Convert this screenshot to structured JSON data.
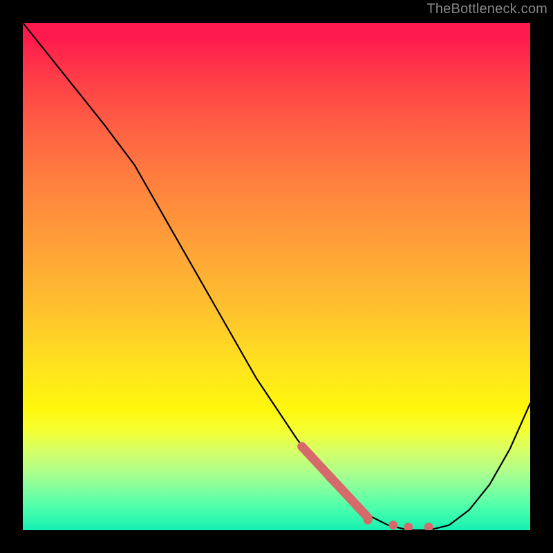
{
  "watermark": "TheBottleneck.com",
  "chart_data": {
    "type": "line",
    "title": "",
    "xlabel": "",
    "ylabel": "",
    "xlim": [
      0,
      100
    ],
    "ylim": [
      0,
      100
    ],
    "grid": false,
    "legend": false,
    "background_gradient": {
      "direction": "vertical",
      "stops": [
        {
          "pos": 0.0,
          "color": "#ff1a4d"
        },
        {
          "pos": 0.35,
          "color": "#ff8a3d"
        },
        {
          "pos": 0.68,
          "color": "#ffe41e"
        },
        {
          "pos": 0.88,
          "color": "#b4ff88"
        },
        {
          "pos": 1.0,
          "color": "#17efb2"
        }
      ]
    },
    "series": [
      {
        "name": "bottleneck-curve",
        "x": [
          0,
          8,
          16,
          22,
          30,
          38,
          46,
          54,
          60,
          64,
          68,
          72,
          76,
          80,
          84,
          88,
          92,
          96,
          100
        ],
        "y": [
          100,
          90,
          80,
          72,
          58,
          44,
          30,
          18,
          10,
          6,
          3,
          1,
          0,
          0,
          1,
          4,
          9,
          16,
          25
        ]
      }
    ],
    "highlight_segment": {
      "name": "thick-salmon-segment",
      "x": [
        55,
        68
      ],
      "y": [
        16.5,
        2.5
      ]
    },
    "highlight_points": {
      "name": "salmon-dots",
      "points": [
        {
          "x": 68,
          "y": 2.0
        },
        {
          "x": 73,
          "y": 1.0
        },
        {
          "x": 76,
          "y": 0.6
        },
        {
          "x": 80,
          "y": 0.6
        }
      ]
    }
  }
}
